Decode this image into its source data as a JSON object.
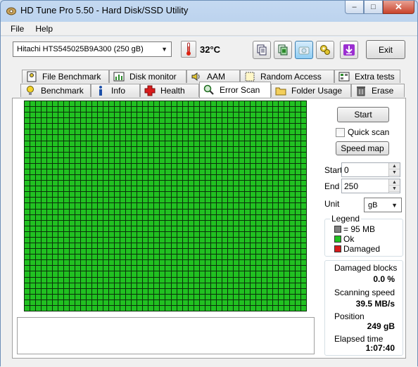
{
  "window": {
    "title": "HD Tune Pro 5.50 - Hard Disk/SSD Utility",
    "min": "–",
    "max": "□",
    "close": "✕"
  },
  "menu": {
    "file": "File",
    "help": "Help"
  },
  "toolbar": {
    "drive": "Hitachi HTS545025B9A300 (250 gB)",
    "temperature": "32°C",
    "exit": "Exit"
  },
  "tabs": {
    "file_benchmark": "File Benchmark",
    "disk_monitor": "Disk monitor",
    "aam": "AAM",
    "random_access": "Random Access",
    "extra_tests": "Extra tests",
    "benchmark": "Benchmark",
    "info": "Info",
    "health": "Health",
    "error_scan": "Error Scan",
    "folder_usage": "Folder Usage",
    "erase": "Erase"
  },
  "scan": {
    "start_button": "Start",
    "quick_scan": "Quick scan",
    "speed_map": "Speed map",
    "start_label": "Start",
    "start_value": "0",
    "end_label": "End",
    "end_value": "250",
    "unit_label": "Unit",
    "unit_value": "gB"
  },
  "legend": {
    "title": "Legend",
    "block": "= 95 MB",
    "ok": "Ok",
    "damaged": "Damaged"
  },
  "stats": {
    "damaged_blocks_label": "Damaged blocks",
    "damaged_blocks_value": "0.0 %",
    "scanning_speed_label": "Scanning speed",
    "scanning_speed_value": "39.5 MB/s",
    "position_label": "Position",
    "position_value": "249 gB",
    "elapsed_label": "Elapsed time",
    "elapsed_value": "1:07:40"
  },
  "colors": {
    "ok": "#21c121",
    "damaged": "#d81b1b",
    "block": "#808080"
  }
}
